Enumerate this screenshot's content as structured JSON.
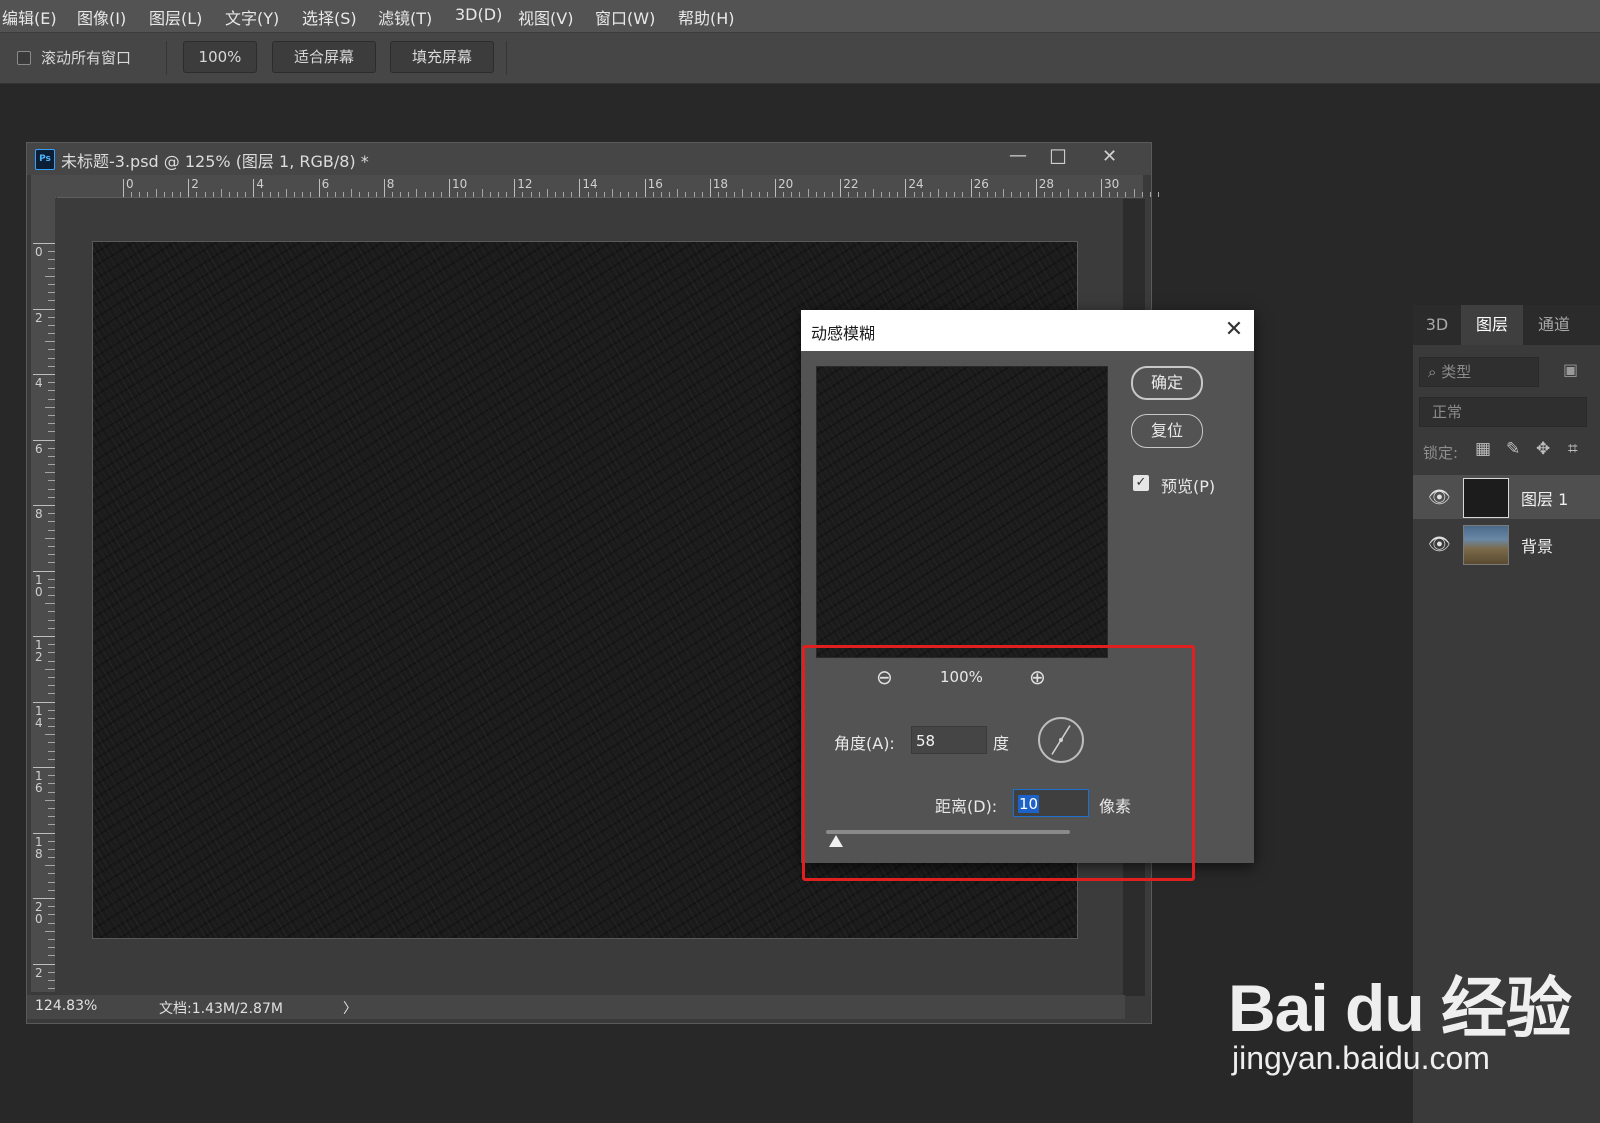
{
  "menu": [
    "编辑(E)",
    "图像(I)",
    "图层(L)",
    "文字(Y)",
    "选择(S)",
    "滤镜(T)",
    "3D(D)",
    "视图(V)",
    "窗口(W)",
    "帮助(H)"
  ],
  "options": {
    "scroll_all_label": "滚动所有窗口",
    "zoom_button": "100%",
    "fit_screen": "适合屏幕",
    "fill_screen": "填充屏幕"
  },
  "document": {
    "title": "未标题-3.psd @ 125% (图层 1, RGB/8) *",
    "ps_badge": "Ps",
    "minimize": "—",
    "maximize": "☐",
    "close": "✕",
    "h_ruler": [
      "0",
      "2",
      "4",
      "6",
      "8",
      "10",
      "12",
      "14",
      "16",
      "18",
      "20",
      "22",
      "24",
      "26",
      "28",
      "30"
    ],
    "v_ruler": [
      "0",
      "2",
      "4",
      "6",
      "8",
      "1\n0",
      "1\n2",
      "1\n4",
      "1\n6",
      "1\n8",
      "2\n0",
      "2"
    ],
    "status_zoom": "124.83%",
    "status_doc": "文档:1.43M/2.87M",
    "status_arrow": "〉"
  },
  "dialog": {
    "title": "动感模糊",
    "close": "✕",
    "ok": "确定",
    "reset": "复位",
    "preview_label": "预览(P)",
    "preview_checked": true,
    "zoom_level": "100%",
    "angle_label": "角度(A):",
    "angle_value": "58",
    "angle_unit": "度",
    "distance_label": "距离(D):",
    "distance_value": "10",
    "distance_unit": "像素",
    "distance_slider_fraction": 0.04
  },
  "panel": {
    "tabs": [
      "3D",
      "图层",
      "通道"
    ],
    "active_tab": "图层",
    "filter_placeholder": "类型",
    "blend_mode": "正常",
    "lock_label": "锁定:",
    "layers": [
      {
        "name": "图层 1",
        "selected": true
      },
      {
        "name": "背景",
        "selected": false
      }
    ]
  },
  "watermark": {
    "logo_text": "Bai du 经验",
    "url": "jingyan.baidu.com"
  },
  "colors": {
    "highlight": "#e0201e",
    "selection_blue": "#1c62c7"
  }
}
